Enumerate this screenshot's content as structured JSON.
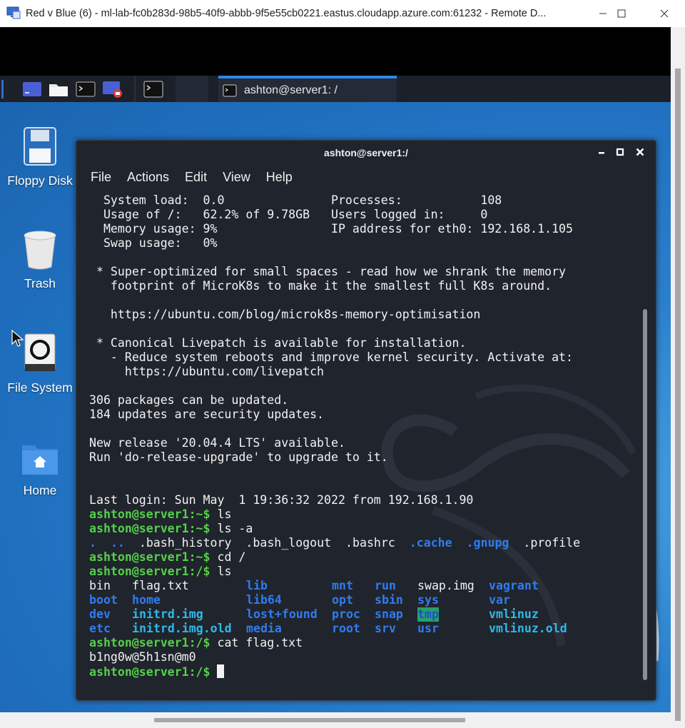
{
  "window": {
    "title": "Red v Blue (6) - ml-lab-fc0b283d-98b5-40f9-abbb-9f5e55cb0221.eastus.cloudapp.azure.com:61232 - Remote D..."
  },
  "taskbar": {
    "active_task_label": "ashton@server1: /"
  },
  "desktop_icons": [
    {
      "label": "Floppy Disk",
      "icon": "floppy-disk-icon"
    },
    {
      "label": "Trash",
      "icon": "trash-icon"
    },
    {
      "label": "File System",
      "icon": "drive-icon"
    },
    {
      "label": "Home",
      "icon": "home-folder-icon"
    }
  ],
  "terminal": {
    "title": "ashton@server1:/",
    "menu": [
      "File",
      "Actions",
      "Edit",
      "View",
      "Help"
    ],
    "lines": {
      "l1": "  System load:  0.0               Processes:           108",
      "l2": "  Usage of /:   62.2% of 9.78GB   Users logged in:     0",
      "l3": "  Memory usage: 9%                IP address for eth0: 192.168.1.105",
      "l4": "  Swap usage:   0%",
      "l6": " * Super-optimized for small spaces - read how we shrank the memory",
      "l7": "   footprint of MicroK8s to make it the smallest full K8s around.",
      "l9": "   https://ubuntu.com/blog/microk8s-memory-optimisation",
      "l11": " * Canonical Livepatch is available for installation.",
      "l12": "   - Reduce system reboots and improve kernel security. Activate at:",
      "l13": "     https://ubuntu.com/livepatch",
      "l15": "306 packages can be updated.",
      "l16": "184 updates are security updates.",
      "l18": "New release '20.04.4 LTS' available.",
      "l19": "Run 'do-release-upgrade' to upgrade to it.",
      "l22": "Last login: Sun May  1 19:36:32 2022 from 192.168.1.90"
    },
    "prompt_home": "ashton@server1:~$ ",
    "prompt_root": "ashton@server1:/$ ",
    "cmd_ls": "ls",
    "cmd_ls_a": "ls -a",
    "cmd_cd": "cd /",
    "cmd_cat": "cat flag.txt",
    "home_listing": {
      "dot": ".",
      "dotdot": "..",
      "bash_history": ".bash_history",
      "bash_logout": ".bash_logout",
      "bashrc": ".bashrc",
      "cache": ".cache",
      "gnupg": ".gnupg",
      "profile": ".profile"
    },
    "root_listing": {
      "row1": [
        "bin",
        "flag.txt",
        "lib",
        "mnt",
        "run",
        "swap.img",
        "vagrant"
      ],
      "row2": [
        "boot",
        "home",
        "lib64",
        "opt",
        "sbin",
        "sys",
        "var"
      ],
      "row3": [
        "dev",
        "initrd.img",
        "lost+found",
        "proc",
        "snap",
        "tmp",
        "vmlinuz"
      ],
      "row4": [
        "etc",
        "initrd.img.old",
        "media",
        "root",
        "srv",
        "usr",
        "vmlinuz.old"
      ]
    },
    "flag_output": "b1ng0w@5h1sn@m0"
  }
}
